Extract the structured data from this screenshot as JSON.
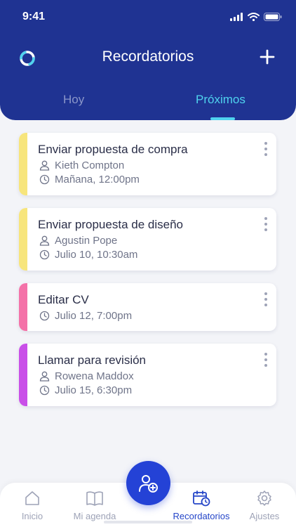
{
  "status_bar": {
    "time": "9:41"
  },
  "header": {
    "title": "Recordatorios"
  },
  "tabs": [
    {
      "label": "Hoy",
      "active": false
    },
    {
      "label": "Próximos",
      "active": true
    }
  ],
  "reminders": [
    {
      "title": "Enviar propuesta de compra",
      "person": "Kieth Compton",
      "time": "Mañana, 12:00pm",
      "color": "#f7e57c"
    },
    {
      "title": "Enviar propuesta de diseño",
      "person": "Agustin Pope",
      "time": "Julio 10, 10:30am",
      "color": "#f7e57c"
    },
    {
      "title": "Editar CV",
      "person": "",
      "time": "Julio 12, 7:00pm",
      "color": "#f472a8"
    },
    {
      "title": "Llamar para revisión",
      "person": "Rowena Maddox",
      "time": "Julio 15, 6:30pm",
      "color": "#c94fe8"
    }
  ],
  "bottom_nav": [
    {
      "label": "Inicio",
      "icon": "home-icon",
      "active": false
    },
    {
      "label": "Mi agenda",
      "icon": "book-icon",
      "active": false
    },
    {
      "label": "Recordatorios",
      "icon": "calendar-clock-icon",
      "active": true
    },
    {
      "label": "Ajustes",
      "icon": "gear-icon",
      "active": false
    }
  ],
  "fab": {
    "icon": "add-contact-icon"
  },
  "colors": {
    "header": "#1f3392",
    "accent": "#4fd3ee",
    "primary": "#2442d6"
  }
}
